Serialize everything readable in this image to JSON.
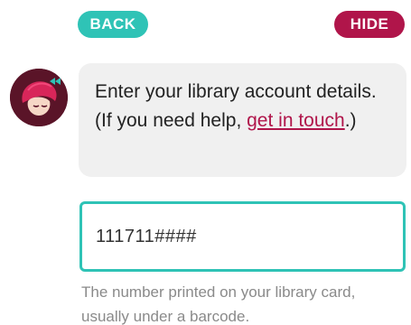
{
  "header": {
    "back_label": "BACK",
    "hide_label": "HIDE"
  },
  "message": {
    "text_before_link": "Enter your library account details. (If you need help, ",
    "link_text": "get in touch",
    "text_after_link": ".)"
  },
  "form": {
    "card_number_value": "111711####",
    "helper_text": "The number printed on your library card, usually under a barcode."
  },
  "icons": {
    "avatar": "libby-character-avatar-icon"
  },
  "colors": {
    "accent_teal": "#2fc3b6",
    "accent_crimson": "#b0154a",
    "bubble_bg": "#f0f0f0"
  }
}
